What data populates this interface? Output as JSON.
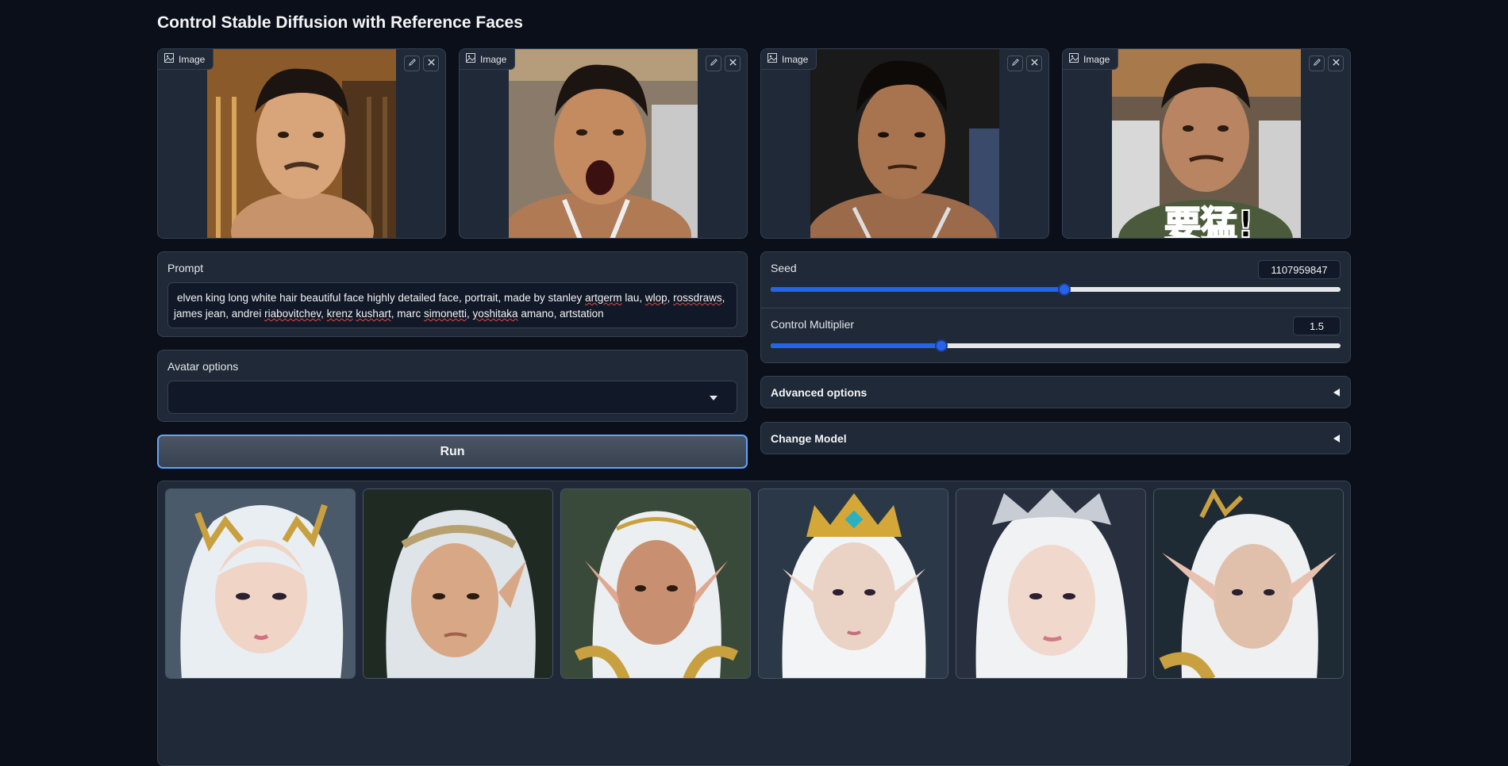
{
  "page": {
    "title": "Control Stable Diffusion with Reference Faces"
  },
  "inputs": {
    "image_label": "Image",
    "images": [
      {
        "name": "reference-face-1",
        "bg": "#8a5a2b"
      },
      {
        "name": "reference-face-2",
        "bg": "#7a6a5a"
      },
      {
        "name": "reference-face-3",
        "bg": "#1a1a1a"
      },
      {
        "name": "reference-face-4",
        "bg": "#6b5a4a"
      }
    ],
    "overlay_text": "要猛!"
  },
  "prompt": {
    "label": "Prompt",
    "segments": [
      "elven king long white hair beautiful face highly detailed face, portrait, made by stanley ",
      "artgerm",
      " lau, ",
      "wlop",
      ", ",
      "rossdraws",
      ",",
      " james jean, andrei ",
      "riabovitchev",
      ", ",
      "krenz",
      " ",
      "kushart",
      ", marc ",
      "simonetti",
      ", ",
      "yoshitaka",
      " amano, artstation"
    ]
  },
  "avatar": {
    "label": "Avatar options",
    "value": ""
  },
  "run": {
    "label": "Run"
  },
  "seed": {
    "label": "Seed",
    "value": "1107959847",
    "fraction": 0.516
  },
  "control": {
    "label": "Control Multiplier",
    "value": "1.5",
    "fraction": 0.3
  },
  "accordions": {
    "advanced": "Advanced options",
    "model": "Change Model"
  },
  "colors": {
    "accent": "#2563eb",
    "run_border": "#60a5fa",
    "panel": "#1f2937",
    "bg": "#0b0f19"
  }
}
